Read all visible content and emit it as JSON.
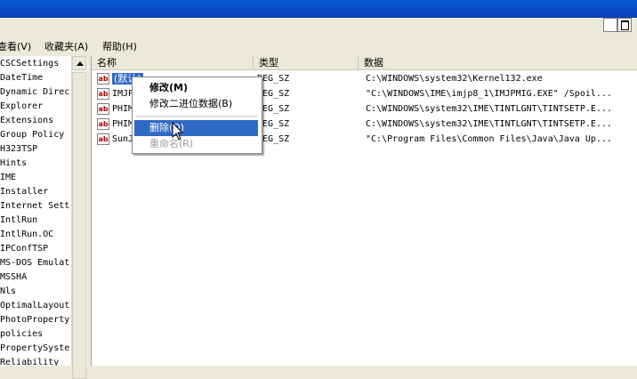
{
  "menubar": [
    {
      "label": "查看(V)"
    },
    {
      "label": "收藏夹(A)"
    },
    {
      "label": "帮助(H)"
    }
  ],
  "tree": {
    "items": [
      "CSCSettings",
      "DateTime",
      "Dynamic Direc",
      "Explorer",
      "Extensions",
      "Group Policy",
      "H323TSP",
      "Hints",
      "IME",
      "Installer",
      "Internet Sett",
      "IntlRun",
      "IntlRun.OC",
      "IPConfTSP",
      "MS-DOS Emulat",
      "MSSHA",
      "Nls",
      "OptimalLayout",
      "PhotoProperty",
      "policies",
      "PropertySyste",
      "Reliability"
    ]
  },
  "list": {
    "columns": [
      "名称",
      "类型",
      "数据"
    ],
    "rows": [
      {
        "name": "(默认)",
        "type": "REG_SZ",
        "data": "C:\\WINDOWS\\system32\\Kernel132.exe"
      },
      {
        "name": "IMJP",
        "type": "REG_SZ",
        "data": "\"C:\\WINDOWS\\IME\\imjp8_1\\IMJPMIG.EXE\" /Spoil..."
      },
      {
        "name": "PHIM",
        "type": "REG_SZ",
        "data": "C:\\WINDOWS\\system32\\IME\\TINTLGNT\\TINTSETP.E..."
      },
      {
        "name": "PHIM",
        "type": "REG_SZ",
        "data": "C:\\WINDOWS\\system32\\IME\\TINTLGNT\\TINTSETP.E..."
      },
      {
        "name": "SunJ",
        "type": "REG_SZ",
        "data": "\"C:\\Program Files\\Common Files\\Java\\Java Up..."
      }
    ],
    "icon_label": "ab"
  },
  "context_menu": {
    "modify": "修改(M)",
    "modify_binary": "修改二进位数据(B)",
    "delete": "删除(D)",
    "rename": "重命名(R)"
  }
}
